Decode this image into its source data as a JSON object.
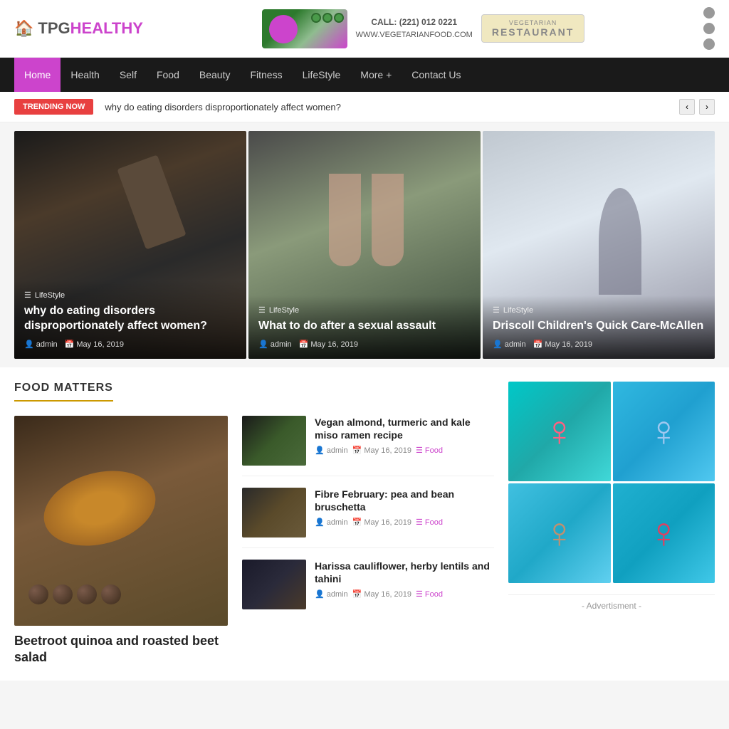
{
  "site": {
    "logo_prefix": "TPG",
    "logo_highlight": "HEALTHY",
    "tagline": "VEGETARIAN",
    "phone": "CALL: (221) 012 0221",
    "website": "WWW.VEGETARIANFOOD.COM",
    "restaurant_label": "RESTAURANT"
  },
  "nav": {
    "items": [
      {
        "label": "Home",
        "active": true
      },
      {
        "label": "Health"
      },
      {
        "label": "Self"
      },
      {
        "label": "Food"
      },
      {
        "label": "Beauty"
      },
      {
        "label": "Fitness"
      },
      {
        "label": "LifeStyle"
      },
      {
        "label": "More +"
      },
      {
        "label": "Contact Us"
      }
    ]
  },
  "trending": {
    "badge": "TRENDING NOW",
    "text": "why do eating disorders disproportionately affect women?"
  },
  "featured": [
    {
      "category": "LifeStyle",
      "title": "why do eating disorders disproportionately affect women?",
      "author": "admin",
      "date": "May 16, 2019"
    },
    {
      "category": "LifeStyle",
      "title": "What to do after a sexual assault",
      "author": "admin",
      "date": "May 16, 2019"
    },
    {
      "category": "LifeStyle",
      "title": "Driscoll Children's Quick Care-McAllen",
      "author": "admin",
      "date": "May 16, 2019"
    }
  ],
  "food_section": {
    "title": "FOOD MATTERS",
    "main_article": {
      "title": "Beetroot quinoa and roasted beet salad"
    },
    "list_articles": [
      {
        "title": "Vegan almond, turmeric and kale miso ramen recipe",
        "author": "admin",
        "date": "May 16, 2019",
        "category": "Food"
      },
      {
        "title": "Fibre February: pea and bean bruschetta",
        "author": "admin",
        "date": "May 16, 2019",
        "category": "Food"
      },
      {
        "title": "Harissa cauliflower, herby lentils and tahini",
        "author": "admin",
        "date": "May 16, 2019",
        "category": "Food"
      }
    ]
  },
  "sidebar": {
    "advertisment": "- Advertisment -"
  }
}
